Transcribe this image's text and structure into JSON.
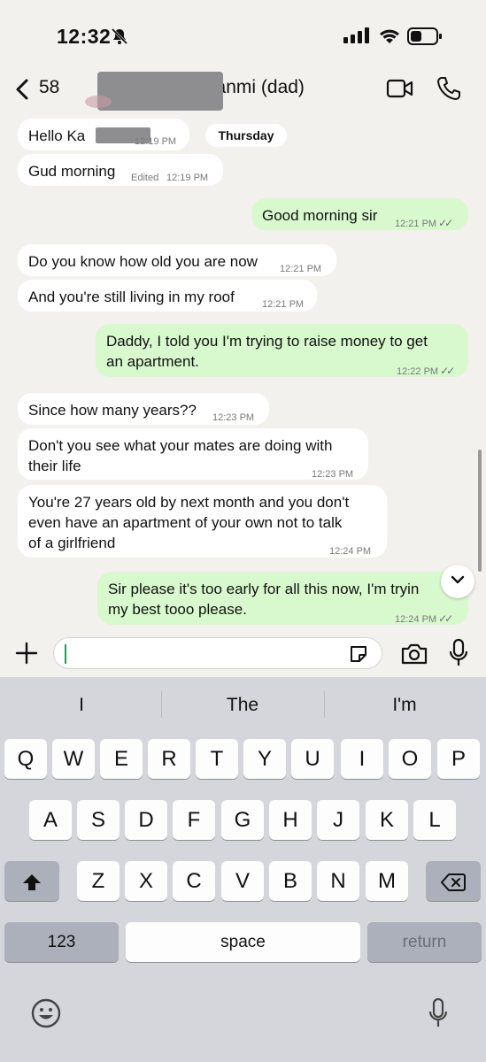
{
  "status_bar": {
    "time": "12:32",
    "icons": [
      "bell-slash-icon",
      "signal-icon",
      "wifi-icon",
      "battery-icon"
    ]
  },
  "header": {
    "name": "58                    nkanmi (dad)",
    "name_prefix": "58",
    "name_suffix": "nkanmi (dad)"
  },
  "chat": {
    "day_label": "Thursday",
    "messages": [
      {
        "dir": "in",
        "text": "Hello Ka",
        "time": "12:19 PM"
      },
      {
        "dir": "in",
        "text": "Gud morning",
        "edited": "Edited",
        "time": "12:19 PM"
      },
      {
        "dir": "out",
        "text": "Good morning sir",
        "time": "12:21 PM",
        "ticks": "✓✓"
      },
      {
        "dir": "in",
        "text": "Do you know how old you are now",
        "time": "12:21 PM"
      },
      {
        "dir": "in",
        "text": "And you're still living in my roof",
        "time": "12:21 PM"
      },
      {
        "dir": "out",
        "text": "Daddy, I told you I'm trying to raise money to get an apartment.",
        "line1": "Daddy, I told you I'm trying to raise money to get",
        "line2": "an apartment.",
        "time": "12:22 PM",
        "ticks": "✓✓"
      },
      {
        "dir": "in",
        "text": "Since how many years??",
        "time": "12:23 PM"
      },
      {
        "dir": "in",
        "line1": "Don't you see what your mates are doing with",
        "line2": "their life",
        "time": "12:23 PM"
      },
      {
        "dir": "in",
        "line1": "You're 27 years old by next month and you don't",
        "line2": "even have an apartment of your own not to talk",
        "line3": "of a girlfriend",
        "time": "12:24 PM"
      },
      {
        "dir": "out",
        "line1": "Sir please it's too early for all this now, I'm tryin",
        "line2": "my best tooo please.",
        "time": "12:24 PM",
        "ticks": "✓✓"
      }
    ]
  },
  "compose": {
    "placeholder": "",
    "icons": [
      "plus-icon",
      "sticker-icon",
      "camera-icon",
      "microphone-icon"
    ]
  },
  "keyboard": {
    "suggestions": [
      "I",
      "The",
      "I'm"
    ],
    "row1": [
      "Q",
      "W",
      "E",
      "R",
      "T",
      "Y",
      "U",
      "I",
      "O",
      "P"
    ],
    "row2": [
      "A",
      "S",
      "D",
      "F",
      "G",
      "H",
      "J",
      "K",
      "L"
    ],
    "row3": [
      "Z",
      "X",
      "C",
      "V",
      "B",
      "N",
      "M"
    ],
    "numbers_label": "123",
    "space_label": "space",
    "return_label": "return"
  },
  "colors": {
    "incoming_bubble": "#ffffff",
    "outgoing_bubble": "#d8f9cd",
    "background": "#f2f1ee",
    "keyboard": "#d4d6dc"
  }
}
